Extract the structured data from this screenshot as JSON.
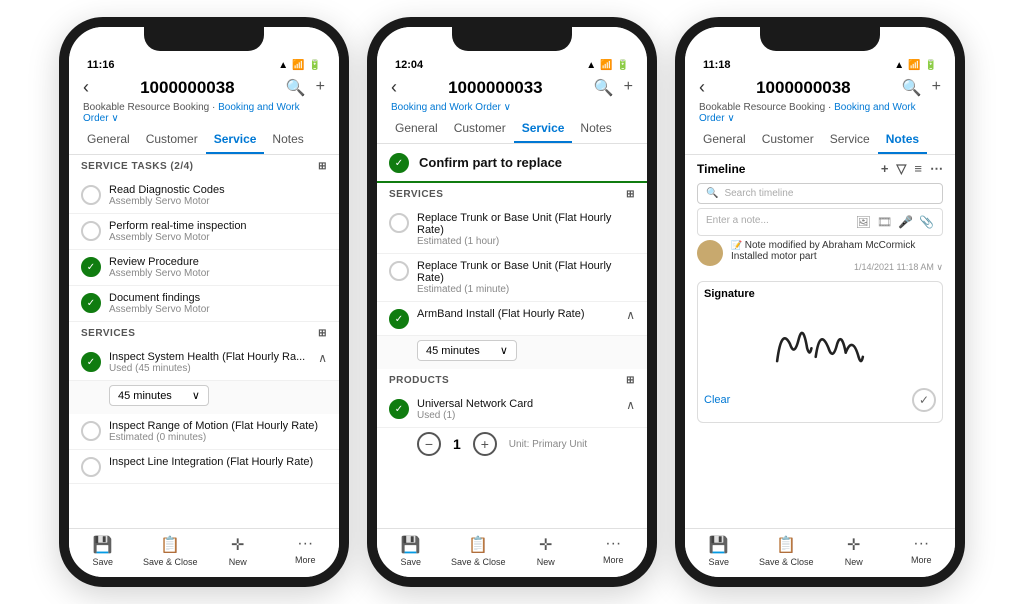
{
  "phone1": {
    "statusBar": {
      "time": "11:16",
      "signal": "▲▼",
      "wifi": "WiFi",
      "battery": "Battery"
    },
    "navTitle": "1000000038",
    "subtitle1": "Bookable Resource Booking ·",
    "subtitle2": "Booking and Work Order ∨",
    "tabs": [
      "General",
      "Customer",
      "Service",
      "Notes"
    ],
    "activeTab": 2,
    "serviceTasks": {
      "header": "SERVICE TASKS (2/4)",
      "items": [
        {
          "done": false,
          "title": "Read Diagnostic Codes",
          "sub": "Assembly Servo Motor"
        },
        {
          "done": false,
          "title": "Perform real-time inspection",
          "sub": "Assembly Servo Motor"
        },
        {
          "done": true,
          "title": "Review Procedure",
          "sub": "Assembly Servo Motor"
        },
        {
          "done": true,
          "title": "Document findings",
          "sub": "Assembly Servo Motor"
        }
      ]
    },
    "services": {
      "header": "SERVICES",
      "items": [
        {
          "done": true,
          "title": "Inspect System Health (Flat Hourly Ra...",
          "sub": "Used (45 minutes)",
          "expanded": true,
          "duration": "45 minutes"
        },
        {
          "done": false,
          "title": "Inspect Range of Motion (Flat Hourly Rate)",
          "sub": "Estimated (0 minutes)",
          "expanded": false
        },
        {
          "done": false,
          "title": "Inspect Line Integration (Flat Hourly Rate)",
          "sub": "",
          "expanded": false
        }
      ]
    },
    "bottomBar": [
      "Save",
      "Save & Close",
      "New",
      "More"
    ]
  },
  "phone2": {
    "statusBar": {
      "time": "12:04"
    },
    "navTitle": "1000000033",
    "subtitle2": "Booking and Work Order ∨",
    "tabs": [
      "General",
      "Customer",
      "Service",
      "Notes"
    ],
    "activeTab": 2,
    "confirmTask": {
      "done": true,
      "title": "Confirm part to replace"
    },
    "services": {
      "header": "SERVICES",
      "items": [
        {
          "done": false,
          "title": "Replace Trunk or Base Unit (Flat Hourly Rate)",
          "sub": "Estimated (1 hour)",
          "expanded": false
        },
        {
          "done": false,
          "title": "Replace Trunk or Base Unit (Flat Hourly Rate)",
          "sub": "Estimated (1 minute)",
          "expanded": false
        },
        {
          "done": true,
          "title": "ArmBand Install (Flat Hourly Rate)",
          "sub": "",
          "expanded": true,
          "duration": "45 minutes"
        }
      ]
    },
    "products": {
      "header": "PRODUCTS",
      "items": [
        {
          "done": true,
          "title": "Universal Network Card",
          "sub": "Used (1)",
          "expanded": true,
          "qty": "1",
          "unit": "Unit: Primary Unit"
        }
      ]
    },
    "bottomBar": [
      "Save",
      "Save & Close",
      "New",
      "More"
    ]
  },
  "phone3": {
    "statusBar": {
      "time": "11:18"
    },
    "navTitle": "1000000038",
    "subtitle1": "Bookable Resource Booking ·",
    "subtitle2": "Booking and Work Order ∨",
    "tabs": [
      "General",
      "Customer",
      "Service",
      "Notes"
    ],
    "activeTab": 3,
    "timeline": {
      "label": "Timeline",
      "searchPlaceholder": "Search timeline",
      "notePlaceholder": "Enter a note...",
      "noteIcons": [
        "🖼",
        "🎞",
        "🎤",
        "📎"
      ],
      "entry": {
        "author": "Note modified by Abraham McCormick",
        "text": "Installed motor part",
        "date": "1/14/2021 11:18 AM ∨"
      }
    },
    "signature": {
      "label": "Signature",
      "clearLabel": "Clear"
    },
    "bottomBar": [
      "Save",
      "Save & Close",
      "New",
      "More"
    ]
  },
  "icons": {
    "back": "‹",
    "search": "🔍",
    "plus": "+",
    "check": "✓",
    "chevronDown": "∨",
    "grid": "⊞",
    "save": "💾",
    "saveClose": "📋",
    "new": "+",
    "more": "···"
  }
}
